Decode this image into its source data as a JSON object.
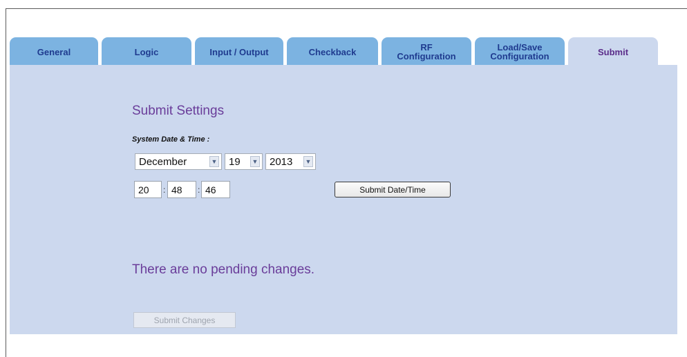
{
  "tabs": [
    {
      "label": "General"
    },
    {
      "label": "Logic"
    },
    {
      "label": "Input / Output"
    },
    {
      "label": "Checkback"
    },
    {
      "line1": "RF",
      "line2": "Configuration"
    },
    {
      "line1": "Load/Save",
      "line2": "Configuration"
    },
    {
      "label": "Submit",
      "active": true
    }
  ],
  "main": {
    "title": "Submit Settings",
    "date_label": "System Date & Time :",
    "month": "December",
    "day": "19",
    "year": "2013",
    "hour": "20",
    "minute": "48",
    "second": "46",
    "time_sep": ":",
    "submit_datetime_label": "Submit Date/Time",
    "pending_message": "There are no pending changes.",
    "submit_changes_label": "Submit Changes"
  },
  "colors": {
    "tab_inactive": "#7cb3e1",
    "tab_active": "#ccd8ee",
    "panel": "#ccd8ee",
    "heading": "#6a3d9a"
  }
}
